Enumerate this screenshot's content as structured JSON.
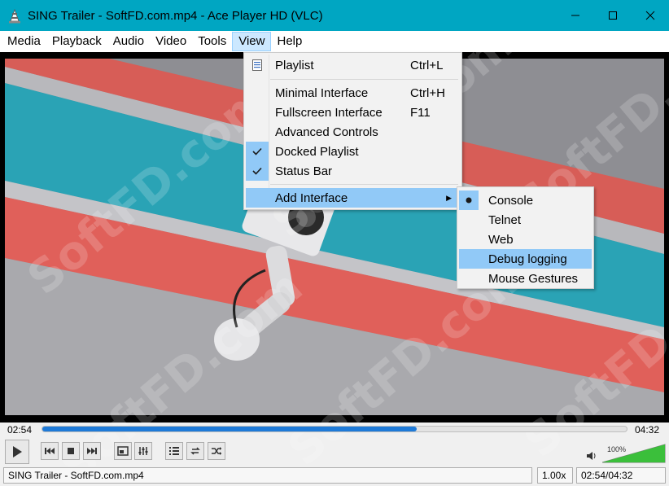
{
  "window": {
    "title": "SING Trailer - SoftFD.com.mp4 - Ace Player HD (VLC)",
    "minimize_glyph": "—",
    "maximize_glyph": "☐",
    "close_glyph": "✕"
  },
  "menubar": {
    "items": [
      {
        "label": "Media"
      },
      {
        "label": "Playback"
      },
      {
        "label": "Audio"
      },
      {
        "label": "Video"
      },
      {
        "label": "Tools"
      },
      {
        "label": "View",
        "active": true
      },
      {
        "label": "Help"
      }
    ]
  },
  "view_menu": {
    "items": [
      {
        "label": "Playlist",
        "shortcut": "Ctrl+L",
        "icon": "playlist-icon"
      },
      {
        "label": "Minimal Interface",
        "shortcut": "Ctrl+H"
      },
      {
        "label": "Fullscreen Interface",
        "shortcut": "F11"
      },
      {
        "label": "Advanced Controls",
        "shortcut": ""
      },
      {
        "label": "Docked Playlist",
        "shortcut": "",
        "checked": true
      },
      {
        "label": "Status Bar",
        "shortcut": "",
        "checked": true
      },
      {
        "label": "Add Interface",
        "shortcut": "",
        "submenu": true,
        "highlighted": true
      }
    ]
  },
  "add_interface_menu": {
    "items": [
      {
        "label": "Console",
        "selected": true
      },
      {
        "label": "Telnet"
      },
      {
        "label": "Web"
      },
      {
        "label": "Debug logging",
        "highlighted": true
      },
      {
        "label": "Mouse Gestures"
      }
    ]
  },
  "watermark": "SoftFD.com",
  "playback": {
    "elapsed": "02:54",
    "total": "04:32",
    "progress": 0.64,
    "volume_label": "100%",
    "volume": 1.0
  },
  "statusbar": {
    "filename": "SING Trailer - SoftFD.com.mp4",
    "speed": "1.00x",
    "time": "02:54/04:32"
  },
  "colors": {
    "titlebar": "#00a6c2",
    "menu_highlight": "#91c9f7",
    "seek_fill": "#1e7ad8",
    "volume_fill": "#3bbf3b"
  }
}
